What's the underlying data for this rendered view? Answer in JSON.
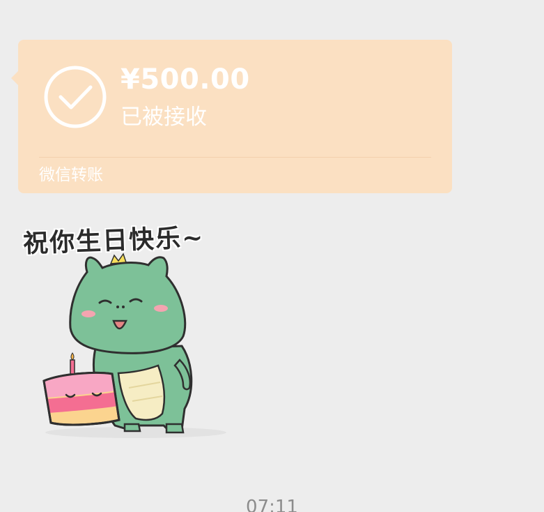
{
  "transfer": {
    "amount": "¥500.00",
    "status": "已被接收",
    "service": "微信转账",
    "icon": "check-circle-icon",
    "background_color": "#fbe0c2"
  },
  "sticker": {
    "caption": "祝你生日快乐~",
    "icon": "birthday-dinosaur-sticker"
  },
  "timestamp": "07:11"
}
